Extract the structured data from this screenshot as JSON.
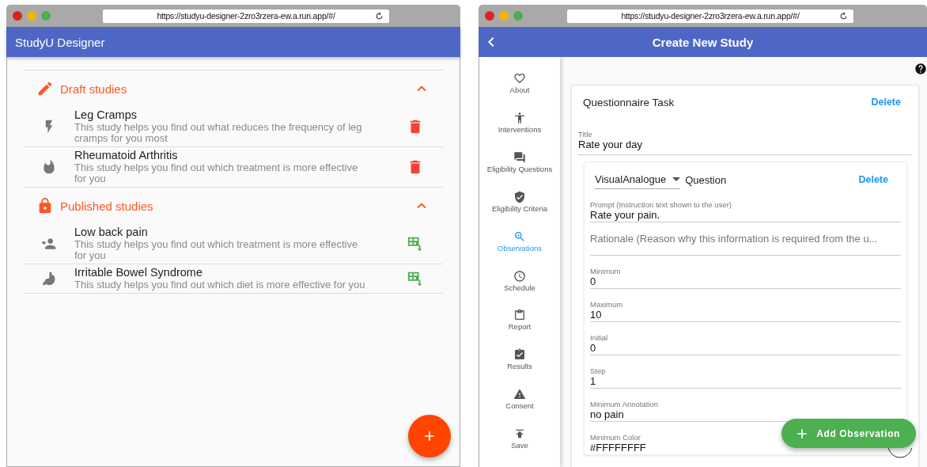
{
  "left_window": {
    "url": "https://studyu-designer-2zro3rzera-ew.a.run.app/#/",
    "app_bar": {
      "title": "StudyU Designer"
    },
    "sections": [
      {
        "kind": "draft",
        "title": "Draft studies",
        "expanded": true,
        "studies": [
          {
            "title": "Leg Cramps",
            "description": "This study helps you find out what reduces the frequency of leg cramps for you most"
          },
          {
            "title": "Rheumatoid Arthritis",
            "description": "This study helps you find out which treatment is more effective for you"
          }
        ]
      },
      {
        "kind": "published",
        "title": "Published studies",
        "expanded": true,
        "studies": [
          {
            "title": "Low back pain",
            "description": "This study helps you find out which treatment is more effective for you"
          },
          {
            "title": "Irritable Bowel Syndrome",
            "description": "This study helps you find out which diet is more effective for you"
          }
        ]
      }
    ]
  },
  "right_window": {
    "url": "https://studyu-designer-2zro3rzera-ew.a.run.app/#/",
    "app_bar": {
      "title": "Create New Study"
    },
    "nav": [
      {
        "label": "About",
        "selected": false
      },
      {
        "label": "Interventions",
        "selected": false
      },
      {
        "label": "Eligibility Questions",
        "selected": false
      },
      {
        "label": "Eligibility Criteria",
        "selected": false
      },
      {
        "label": "Observations",
        "selected": true
      },
      {
        "label": "Schedule",
        "selected": false
      },
      {
        "label": "Report",
        "selected": false
      },
      {
        "label": "Results",
        "selected": false
      },
      {
        "label": "Consent",
        "selected": false
      },
      {
        "label": "Save",
        "selected": false
      }
    ],
    "task_card": {
      "title": "Questionnaire Task",
      "delete": "Delete",
      "title_field": {
        "label": "Title",
        "value": "Rate your day"
      },
      "question": {
        "type_value": "VisualAnalogue",
        "type_suffix": "Question",
        "delete": "Delete",
        "fields": [
          {
            "kind": "filled",
            "label": "Prompt (Instruction text shown to the user)",
            "value": "Rate your pain."
          },
          {
            "kind": "empty",
            "placeholder": "Rationale (Reason why this information is required from the u..."
          },
          {
            "kind": "filled",
            "label": "Minimum",
            "value": "0"
          },
          {
            "kind": "filled",
            "label": "Maximum",
            "value": "10"
          },
          {
            "kind": "filled",
            "label": "Initial",
            "value": "0"
          },
          {
            "kind": "filled",
            "label": "Step",
            "value": "1"
          },
          {
            "kind": "filled",
            "label": "Minimum Annotation",
            "value": "no pain"
          },
          {
            "kind": "filled",
            "label": "Minimum Color",
            "value": "#FFFFFFFF"
          }
        ]
      }
    },
    "add_button": "Add Observation"
  }
}
